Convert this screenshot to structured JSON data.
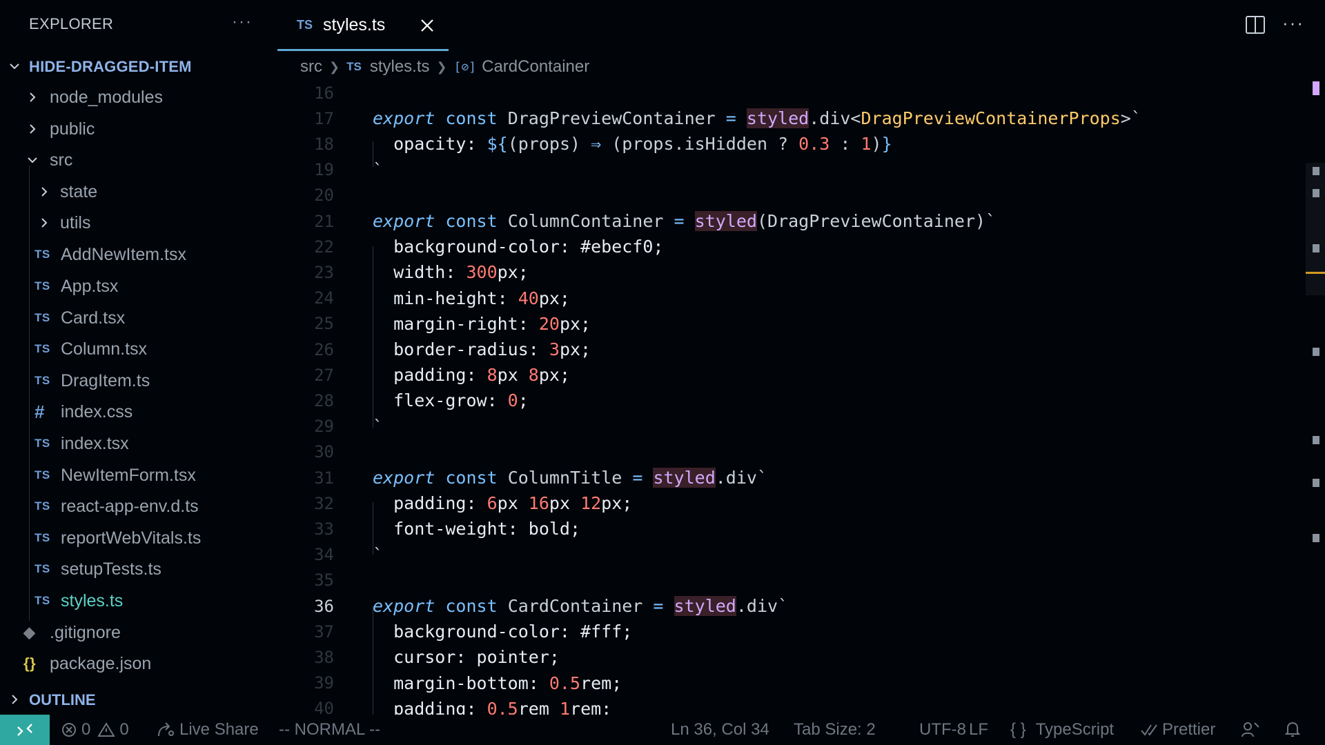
{
  "sidebar": {
    "title": "EXPLORER",
    "more": "···",
    "project": "HIDE-DRAGGED-ITEM",
    "items": [
      {
        "label": "node_modules",
        "kind": "folder"
      },
      {
        "label": "public",
        "kind": "folder"
      },
      {
        "label": "src",
        "kind": "folder-open"
      },
      {
        "label": "state",
        "kind": "folder"
      },
      {
        "label": "utils",
        "kind": "folder"
      },
      {
        "label": "AddNewItem.tsx",
        "icon": "TS"
      },
      {
        "label": "App.tsx",
        "icon": "TS"
      },
      {
        "label": "Card.tsx",
        "icon": "TS"
      },
      {
        "label": "Column.tsx",
        "icon": "TS"
      },
      {
        "label": "DragItem.ts",
        "icon": "TS"
      },
      {
        "label": "index.css",
        "icon": "#"
      },
      {
        "label": "index.tsx",
        "icon": "TS"
      },
      {
        "label": "NewItemForm.tsx",
        "icon": "TS"
      },
      {
        "label": "react-app-env.d.ts",
        "icon": "TS"
      },
      {
        "label": "reportWebVitals.ts",
        "icon": "TS"
      },
      {
        "label": "setupTests.ts",
        "icon": "TS"
      },
      {
        "label": "styles.ts",
        "icon": "TS"
      },
      {
        "label": ".gitignore",
        "icon": "◆"
      },
      {
        "label": "package.json",
        "icon": "{}"
      }
    ],
    "outline": "OUTLINE"
  },
  "tab": {
    "icon": "TS",
    "name": "styles.ts"
  },
  "breadcrumb": {
    "part1": "src",
    "icon2": "TS",
    "part2": "styles.ts",
    "icon3": "[⊘]",
    "part3": "CardContainer"
  },
  "editor": {
    "line_numbers": [
      "16",
      "17",
      "18",
      "19",
      "20",
      "21",
      "22",
      "23",
      "24",
      "25",
      "26",
      "27",
      "28",
      "29",
      "30",
      "31",
      "32",
      "33",
      "34",
      "35",
      "36",
      "37",
      "38",
      "39",
      "40"
    ],
    "current_line": "36"
  },
  "status": {
    "errors": "0",
    "warnings": "0",
    "live_share": "Live Share",
    "mode": "-- NORMAL --",
    "position": "Ln 36, Col 34",
    "tab_size": "Tab Size: 2",
    "encoding": "UTF-8",
    "eol": "LF",
    "language": "TypeScript",
    "formatter": "Prettier"
  },
  "colors": {
    "accent": "#5fa8d3",
    "remote": "#2ea8a0",
    "active_file": "#5fd1c7"
  }
}
